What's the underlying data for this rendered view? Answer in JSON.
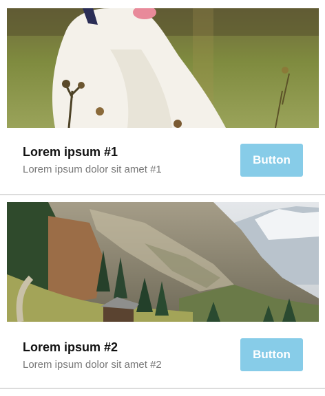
{
  "cards": [
    {
      "image_alt": "white dog sitting in a grassy meadow",
      "title": "Lorem ipsum #1",
      "subtitle": "Lorem ipsum dolor sit amet #1",
      "button_label": "Button"
    },
    {
      "image_alt": "alpine valley with mountains, trees and a wooden hut",
      "title": "Lorem ipsum #2",
      "subtitle": "Lorem ipsum dolor sit amet #2",
      "button_label": "Button"
    }
  ],
  "colors": {
    "button_bg": "#87cce8",
    "button_text": "#ffffff",
    "title": "#111111",
    "subtitle": "#777777",
    "divider": "#dcdcdc"
  }
}
